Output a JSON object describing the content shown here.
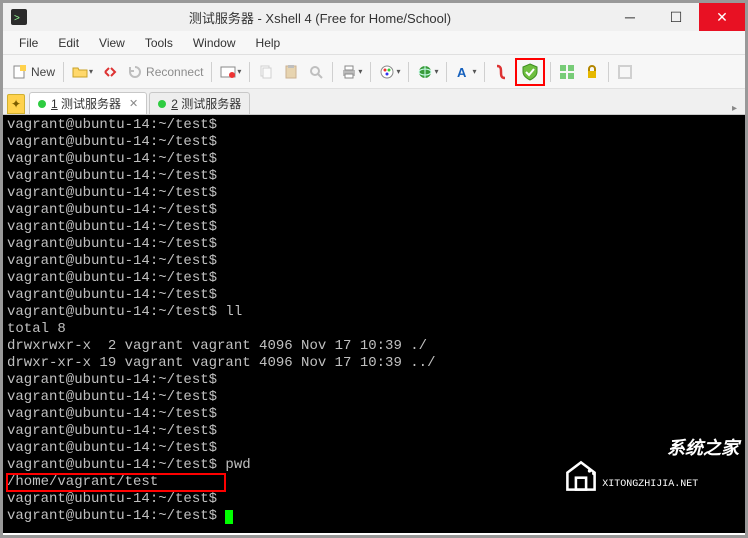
{
  "window": {
    "title": "测试服务器 - Xshell 4 (Free for Home/School)"
  },
  "menu": {
    "file": "File",
    "edit": "Edit",
    "view": "View",
    "tools": "Tools",
    "window": "Window",
    "help": "Help"
  },
  "toolbar": {
    "new": "New",
    "reconnect": "Reconnect"
  },
  "tabs": {
    "tab1_num": "1",
    "tab1_label": " 测试服务器",
    "tab2_num": "2",
    "tab2_label": " 测试服务器"
  },
  "terminal": {
    "lines": [
      "vagrant@ubuntu-14:~/test$",
      "vagrant@ubuntu-14:~/test$",
      "vagrant@ubuntu-14:~/test$",
      "vagrant@ubuntu-14:~/test$",
      "vagrant@ubuntu-14:~/test$",
      "vagrant@ubuntu-14:~/test$",
      "vagrant@ubuntu-14:~/test$",
      "vagrant@ubuntu-14:~/test$",
      "vagrant@ubuntu-14:~/test$",
      "vagrant@ubuntu-14:~/test$",
      "vagrant@ubuntu-14:~/test$",
      "vagrant@ubuntu-14:~/test$ ll",
      "total 8",
      "drwxrwxr-x  2 vagrant vagrant 4096 Nov 17 10:39 ./",
      "drwxr-xr-x 19 vagrant vagrant 4096 Nov 17 10:39 ../",
      "vagrant@ubuntu-14:~/test$",
      "vagrant@ubuntu-14:~/test$",
      "vagrant@ubuntu-14:~/test$",
      "vagrant@ubuntu-14:~/test$",
      "vagrant@ubuntu-14:~/test$",
      "vagrant@ubuntu-14:~/test$ pwd"
    ],
    "pwd_output": "/home/vagrant/test",
    "last1": "vagrant@ubuntu-14:~/test$",
    "last2": "vagrant@ubuntu-14:~/test$ "
  },
  "watermark": {
    "brand": "系统之家",
    "url": "XITONGZHIJIA.NET"
  }
}
